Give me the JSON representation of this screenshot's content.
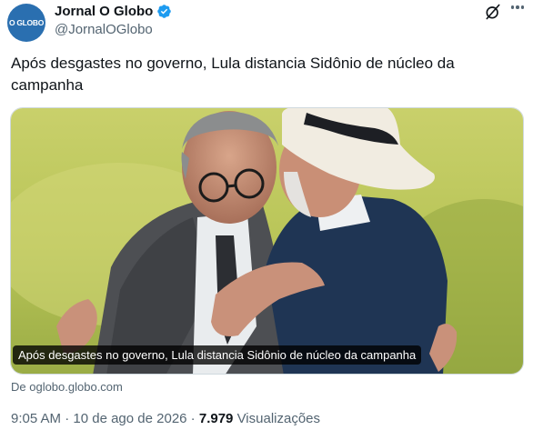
{
  "account": {
    "avatar_text": "O GLOBO",
    "display_name": "Jornal O Globo",
    "handle": "@JornalOGlobo",
    "verified_color": "#1d9bf0"
  },
  "tweet": {
    "text": "Após desgastes no governo, Lula distancia Sidônio de núcleo da campanha"
  },
  "media": {
    "caption": "Após desgastes no governo, Lula distancia Sidônio de núcleo da campanha"
  },
  "link_source": "De oglobo.globo.com",
  "meta": {
    "time": "9:05 AM",
    "sep1": " · ",
    "date": "10 de ago de 2026",
    "sep2": " · ",
    "views_count": "7.979",
    "views_label": " Visualizações"
  },
  "icons": {
    "grok": "grok-icon",
    "more": "more-options-icon",
    "verified": "verified-badge-icon"
  }
}
